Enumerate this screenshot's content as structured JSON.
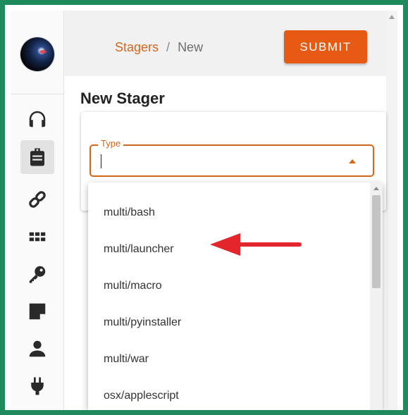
{
  "header": {
    "breadcrumb": {
      "parent": "Stagers",
      "separator": "/",
      "current": "New"
    },
    "submit_label": "SUBMIT"
  },
  "page": {
    "title": "New Stager"
  },
  "form": {
    "type_field": {
      "label": "Type",
      "value": ""
    }
  },
  "dropdown": {
    "options": [
      "multi/bash",
      "multi/launcher",
      "multi/macro",
      "multi/pyinstaller",
      "multi/war",
      "osx/applescript"
    ]
  },
  "sidebar": {
    "items": [
      {
        "icon": "headphones-icon"
      },
      {
        "icon": "briefcase-icon",
        "active": true
      },
      {
        "icon": "link-icon"
      },
      {
        "icon": "grid-icon"
      },
      {
        "icon": "key-icon"
      },
      {
        "icon": "sticky-note-icon"
      },
      {
        "icon": "user-icon"
      },
      {
        "icon": "plug-icon"
      }
    ]
  },
  "colors": {
    "accent": "#d4661c",
    "submit_button": "#e65a14",
    "annotation_arrow": "#e2262b",
    "border_frame": "#1f8a5b"
  }
}
